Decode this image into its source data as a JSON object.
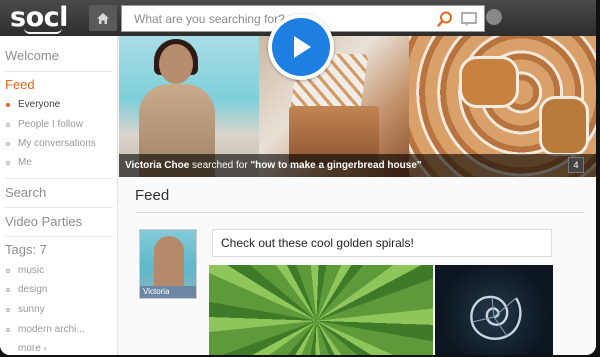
{
  "app": {
    "logo": "socl"
  },
  "search": {
    "placeholder": "What are you searching for?"
  },
  "sidebar": {
    "welcome": "Welcome",
    "feed": "Feed",
    "feed_items": [
      {
        "label": "Everyone",
        "active": true
      },
      {
        "label": "People I follow",
        "active": false
      },
      {
        "label": "My conversations",
        "active": false
      },
      {
        "label": "Me",
        "active": false
      }
    ],
    "search": "Search",
    "video_parties": "Video Parties",
    "tags_header": "Tags: 7",
    "tags": [
      "music",
      "design",
      "sunny",
      "modern archi..."
    ],
    "more": "more ›"
  },
  "hero": {
    "caption_user": "Victoria Choe",
    "caption_middle": " searched for ",
    "caption_query": "\"how to make a gingerbread house\"",
    "count": "4"
  },
  "feed": {
    "title": "Feed",
    "post": {
      "author": "Victoria",
      "text": "Check out these cool golden spirals!"
    }
  },
  "colors": {
    "accent": "#e5671d",
    "play_blue": "#1e7fe2",
    "topbar": "#3a3a3a"
  }
}
